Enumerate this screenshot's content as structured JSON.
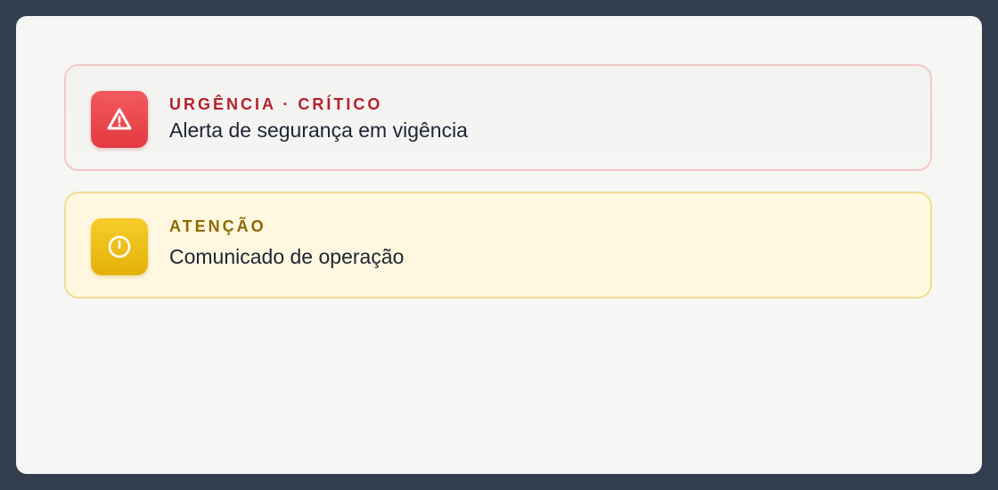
{
  "alerts": [
    {
      "severity": "critical",
      "label": "URGÊNCIA · CRÍTICO",
      "title": "Alerta de segurança em vigência",
      "icon": "warning-triangle-icon",
      "accent": "#e8434a"
    },
    {
      "severity": "warning",
      "label": "ATENÇÃO",
      "title": "Comunicado de operação",
      "icon": "info-circle-icon",
      "accent": "#eebd12"
    }
  ]
}
